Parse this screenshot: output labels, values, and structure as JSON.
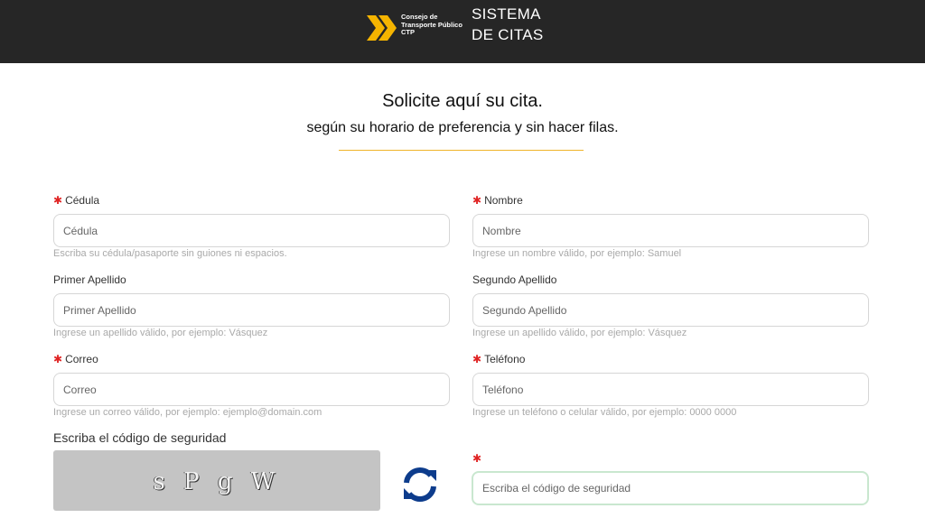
{
  "header": {
    "logo_text": [
      "Consejo de",
      "Transporte Público",
      "CTP"
    ],
    "title_line1": "SISTEMA",
    "title_line2": "DE CITAS"
  },
  "hero": {
    "title": "Solicite aquí su cita.",
    "subtitle": "según su horario de preferencia y sin hacer filas."
  },
  "form": {
    "cedula": {
      "label": "Cédula",
      "placeholder": "Cédula",
      "hint": "Escriba su cédula/pasaporte sin guiones ni espacios."
    },
    "nombre": {
      "label": "Nombre",
      "placeholder": "Nombre",
      "hint": "Ingrese un nombre válido, por ejemplo: Samuel"
    },
    "primer_apellido": {
      "label": "Primer Apellido",
      "placeholder": "Primer Apellido",
      "hint": "Ingrese un apellido válido, por ejemplo: Vásquez"
    },
    "segundo_apellido": {
      "label": "Segundo Apellido",
      "placeholder": "Segundo Apellido",
      "hint": "Ingrese un apellido válido, por ejemplo: Vásquez"
    },
    "correo": {
      "label": "Correo",
      "placeholder": "Correo",
      "hint": "Ingrese un correo válido, por ejemplo: ejemplo@domain.com"
    },
    "telefono": {
      "label": "Teléfono",
      "placeholder": "Teléfono",
      "hint": "Ingrese un teléfono o celular válido, por ejemplo: 0000 0000"
    },
    "required_mark": "✱"
  },
  "captcha": {
    "label": "Escriba el código de seguridad",
    "code": "s P g W",
    "input_placeholder": "Escriba el código de seguridad",
    "refresh_icon": "refresh-icon"
  },
  "colors": {
    "header_bg": "#262626",
    "accent_gold": "#f0b429",
    "required_red": "#e02424",
    "refresh_blue": "#0d3c8c"
  }
}
